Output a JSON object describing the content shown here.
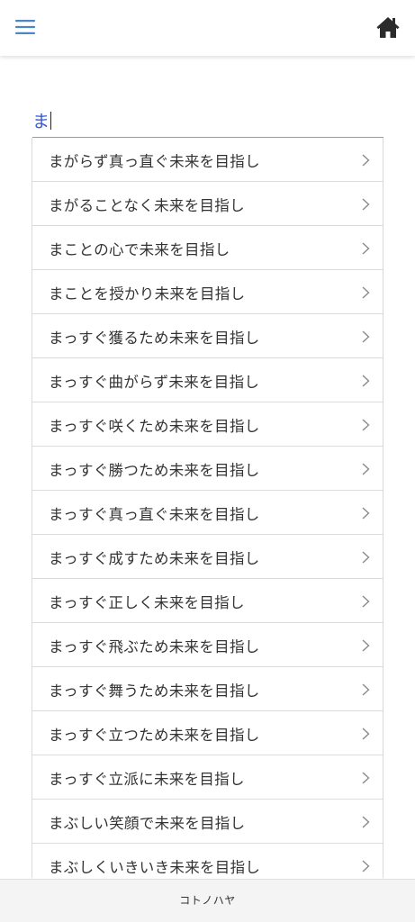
{
  "header": {
    "menu_icon": "hamburger-menu-icon",
    "home_icon": "home-icon",
    "accent_color": "#4a86c8"
  },
  "search": {
    "value": "ま"
  },
  "suggestions": [
    {
      "label": "まがらず真っ直ぐ未来を目指し"
    },
    {
      "label": "まがることなく未来を目指し"
    },
    {
      "label": "まことの心で未来を目指し"
    },
    {
      "label": "まことを授かり未来を目指し"
    },
    {
      "label": "まっすぐ獲るため未来を目指し"
    },
    {
      "label": "まっすぐ曲がらず未来を目指し"
    },
    {
      "label": "まっすぐ咲くため未来を目指し"
    },
    {
      "label": "まっすぐ勝つため未来を目指し"
    },
    {
      "label": "まっすぐ真っ直ぐ未来を目指し"
    },
    {
      "label": "まっすぐ成すため未来を目指し"
    },
    {
      "label": "まっすぐ正しく未来を目指し"
    },
    {
      "label": "まっすぐ飛ぶため未来を目指し"
    },
    {
      "label": "まっすぐ舞うため未来を目指し"
    },
    {
      "label": "まっすぐ立つため未来を目指し"
    },
    {
      "label": "まっすぐ立派に未来を目指し"
    },
    {
      "label": "まぶしい笑顔で未来を目指し"
    },
    {
      "label": "まぶしくいきいき未来を目指し"
    }
  ],
  "footer": {
    "text": "コトノハヤ"
  }
}
